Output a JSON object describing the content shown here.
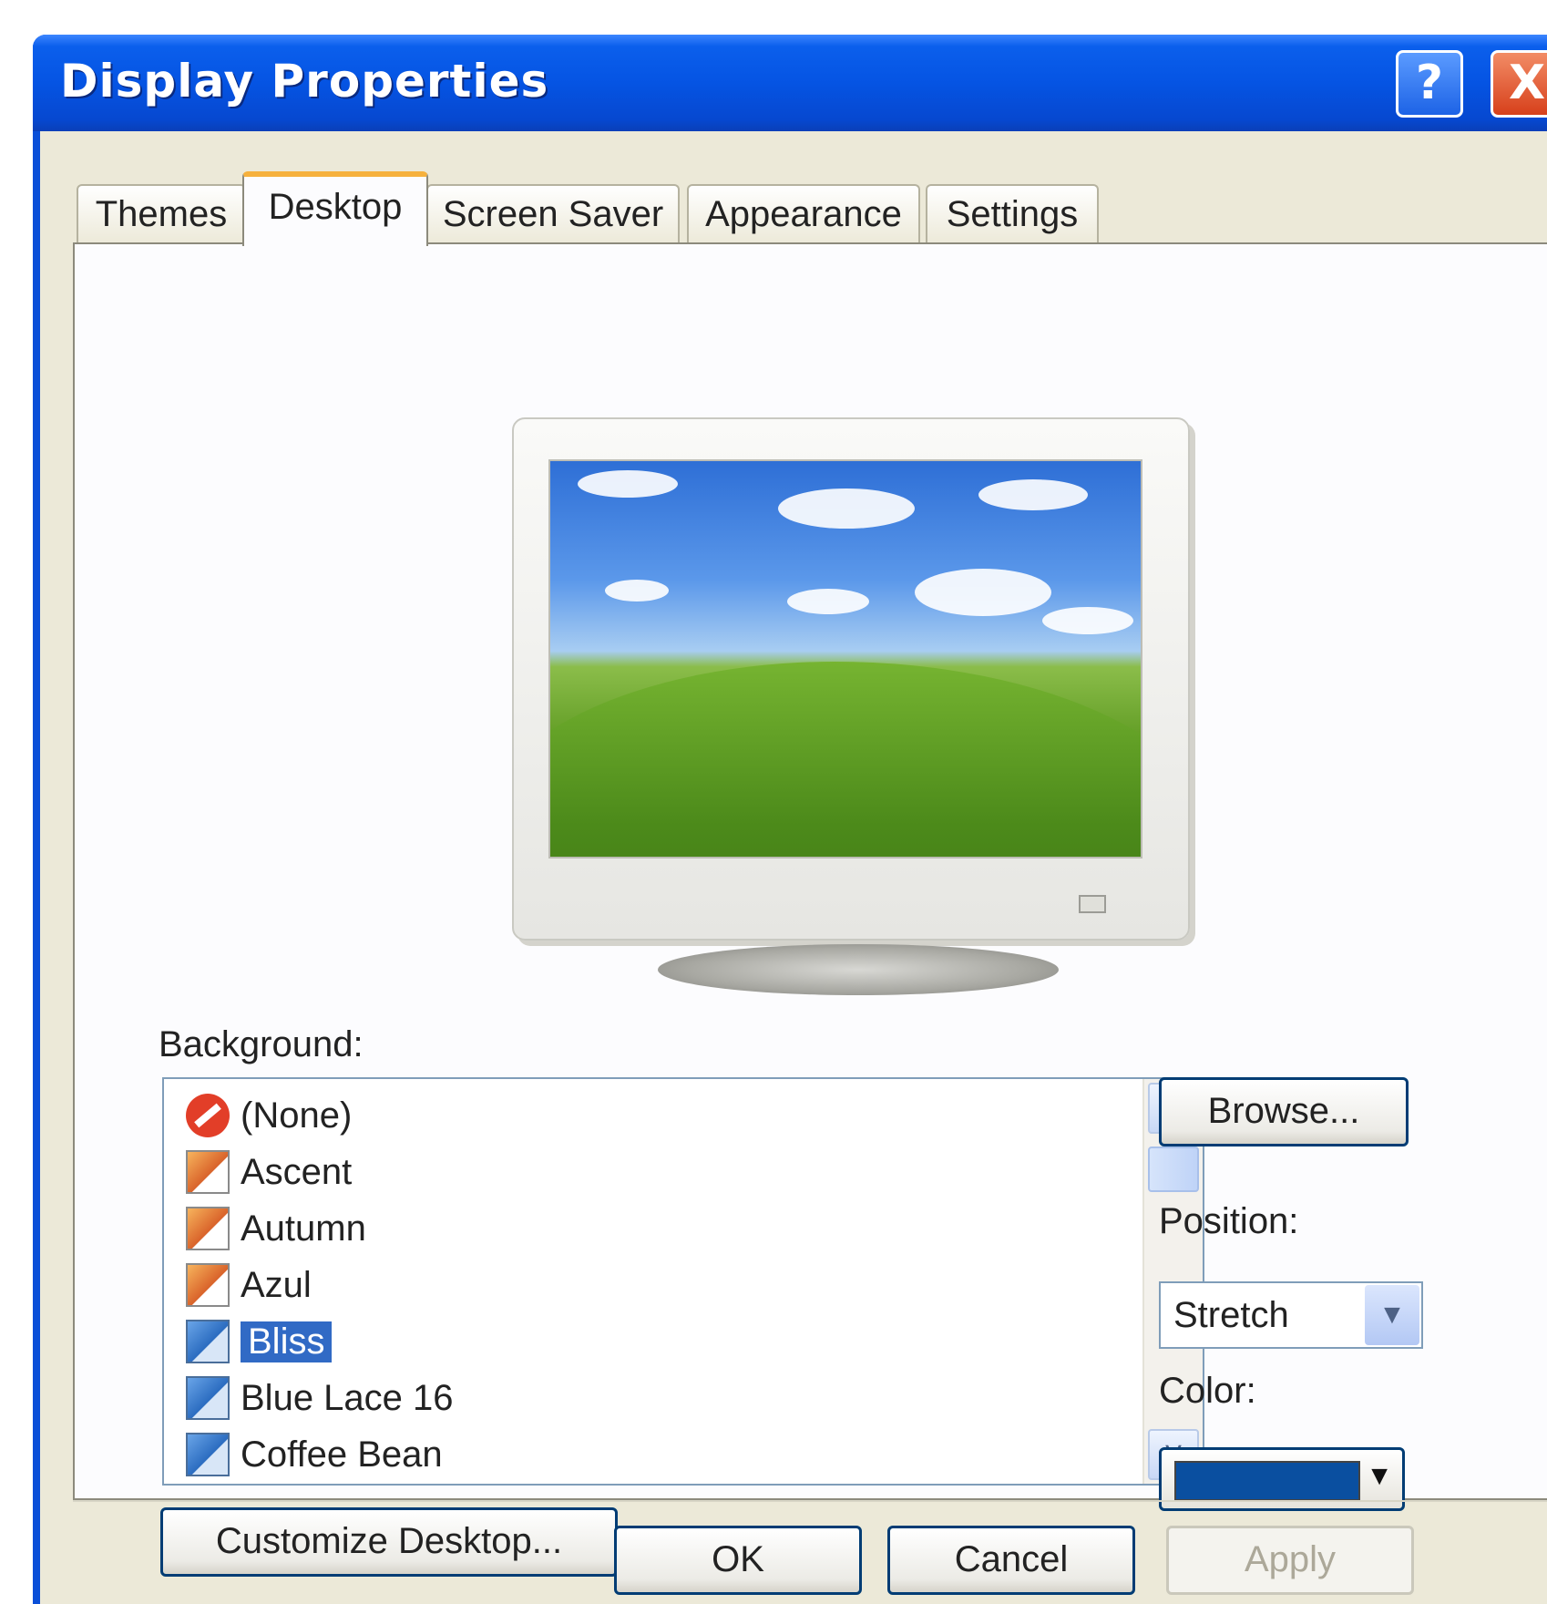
{
  "window": {
    "title": "Display Properties",
    "help_label": "?",
    "close_label": "X"
  },
  "tabs": [
    {
      "label": "Themes",
      "active": false
    },
    {
      "label": "Desktop",
      "active": true
    },
    {
      "label": "Screen Saver",
      "active": false
    },
    {
      "label": "Appearance",
      "active": false
    },
    {
      "label": "Settings",
      "active": false
    }
  ],
  "desktop": {
    "background_label": "Background:",
    "background_items": [
      {
        "label": "(None)",
        "icon": "no-wallpaper-icon",
        "selected": false
      },
      {
        "label": "Ascent",
        "icon": "jpeg-image-icon",
        "selected": false
      },
      {
        "label": "Autumn",
        "icon": "jpeg-image-icon",
        "selected": false
      },
      {
        "label": "Azul",
        "icon": "jpeg-image-icon",
        "selected": false
      },
      {
        "label": "Bliss",
        "icon": "bitmap-image-icon",
        "selected": true
      },
      {
        "label": "Blue Lace 16",
        "icon": "bitmap-image-icon",
        "selected": false
      },
      {
        "label": "Coffee Bean",
        "icon": "bitmap-image-icon",
        "selected": false
      }
    ],
    "browse_label": "Browse...",
    "position_label": "Position:",
    "position_value": "Stretch",
    "color_label": "Color:",
    "color_value": "#0a4fa0",
    "customize_label": "Customize Desktop..."
  },
  "footer": {
    "ok_label": "OK",
    "cancel_label": "Cancel",
    "apply_label": "Apply"
  },
  "colors": {
    "titlebar": "#0554e3",
    "dialog_face": "#ece9d8",
    "selection": "#316ac5",
    "active_tab_accent": "#f6b13d"
  }
}
